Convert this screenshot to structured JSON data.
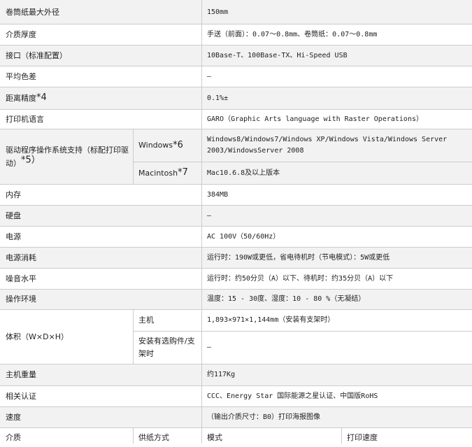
{
  "rows": [
    {
      "label": "卷筒纸最大外径",
      "value": "150mm"
    },
    {
      "label": "介质厚度",
      "value": "手送（前面）：0.07～0.8mm、卷筒纸：0.07～0.8mm"
    },
    {
      "label": "接口（标准配置）",
      "value": "10Base-T、100Base-TX、Hi-Speed USB"
    },
    {
      "label": "平均色差",
      "value": "–"
    },
    {
      "label": "距离精度",
      "label_sup": "*4",
      "value": "0.1%±"
    },
    {
      "label": "打印机语言",
      "value": "GARO（Graphic Arts language with Raster Operations）"
    },
    {
      "label": "驱动程序操作系统支持（标配打印驱动）",
      "label_sup": "*5）",
      "sub": [
        {
          "label": "Windows",
          "label_sup": "*6",
          "value": "Windows8/Windows7/Windows XP/Windows Vista/Windows Server 2003/WindowsServer 2008"
        },
        {
          "label": "Macintosh",
          "label_sup": "*7",
          "value": "Mac10.6.8及以上版本"
        }
      ]
    },
    {
      "label": "内存",
      "value": "384MB"
    },
    {
      "label": "硬盘",
      "value": "–"
    },
    {
      "label": "电源",
      "value": "AC 100V（50/60Hz）"
    },
    {
      "label": "电源消耗",
      "value": "运行时：190W或更低，省电待机时（节电模式）：5W或更低"
    },
    {
      "label": "噪音水平",
      "value": "运行时：约50分贝（A）以下、待机时：约35分贝（A）以下"
    },
    {
      "label": "操作环境",
      "value": "温度：15 - 30度、湿度：10 - 80 %（无凝结）"
    },
    {
      "label": "体积（W×D×H）",
      "sub": [
        {
          "label": "主机",
          "value": "1,893×971×1,144mm（安装有支架时）"
        },
        {
          "label": "安装有选购件/支架时",
          "value": "–"
        }
      ]
    },
    {
      "label": "主机重量",
      "value": "约117Kg"
    },
    {
      "label": "相关认证",
      "value": "CCC、Energy Star 国际能源之星认证、中国版RoHS"
    },
    {
      "label": "速度",
      "value": "（输出介质尺寸：B0）打印海报图像"
    }
  ],
  "footer": {
    "c1": "介质",
    "c2": "供纸方式",
    "c3": "模式",
    "c4": "打印速度"
  }
}
